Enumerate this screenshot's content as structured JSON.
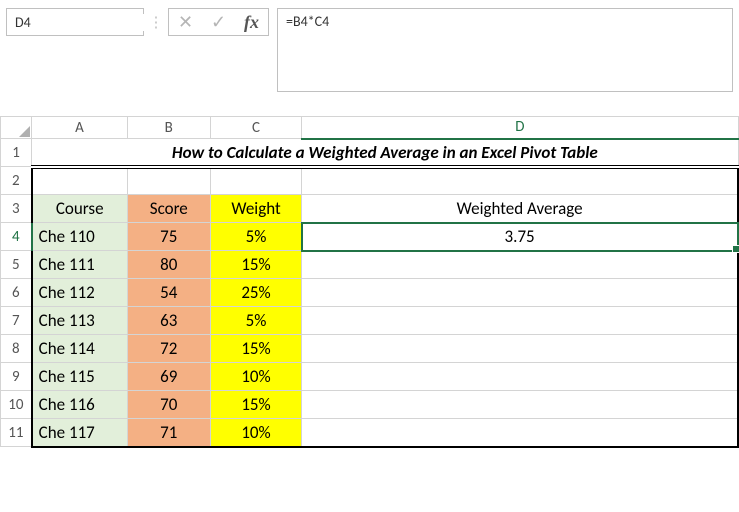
{
  "name_box": "D4",
  "formula": "=B4*C4",
  "fx_label": "fx",
  "col_headers": [
    "A",
    "B",
    "C",
    "D"
  ],
  "row_numbers": [
    "1",
    "2",
    "3",
    "4",
    "5",
    "6",
    "7",
    "8",
    "9",
    "10",
    "11"
  ],
  "title": "How to Calculate a Weighted Average in an Excel Pivot Table",
  "headers": {
    "course": "Course",
    "score": "Score",
    "weight": "Weight",
    "wavg": "Weighted Average"
  },
  "rows": [
    {
      "course": "Che 110",
      "score": "75",
      "weight": "5%",
      "wavg": "3.75"
    },
    {
      "course": "Che 111",
      "score": "80",
      "weight": "15%",
      "wavg": ""
    },
    {
      "course": "Che 112",
      "score": "54",
      "weight": "25%",
      "wavg": ""
    },
    {
      "course": "Che 113",
      "score": "63",
      "weight": "5%",
      "wavg": ""
    },
    {
      "course": "Che 114",
      "score": "72",
      "weight": "15%",
      "wavg": ""
    },
    {
      "course": "Che 115",
      "score": "69",
      "weight": "10%",
      "wavg": ""
    },
    {
      "course": "Che 116",
      "score": "70",
      "weight": "15%",
      "wavg": ""
    },
    {
      "course": "Che 117",
      "score": "71",
      "weight": "10%",
      "wavg": ""
    }
  ],
  "selected_cell": {
    "row": 4,
    "col": "D"
  }
}
